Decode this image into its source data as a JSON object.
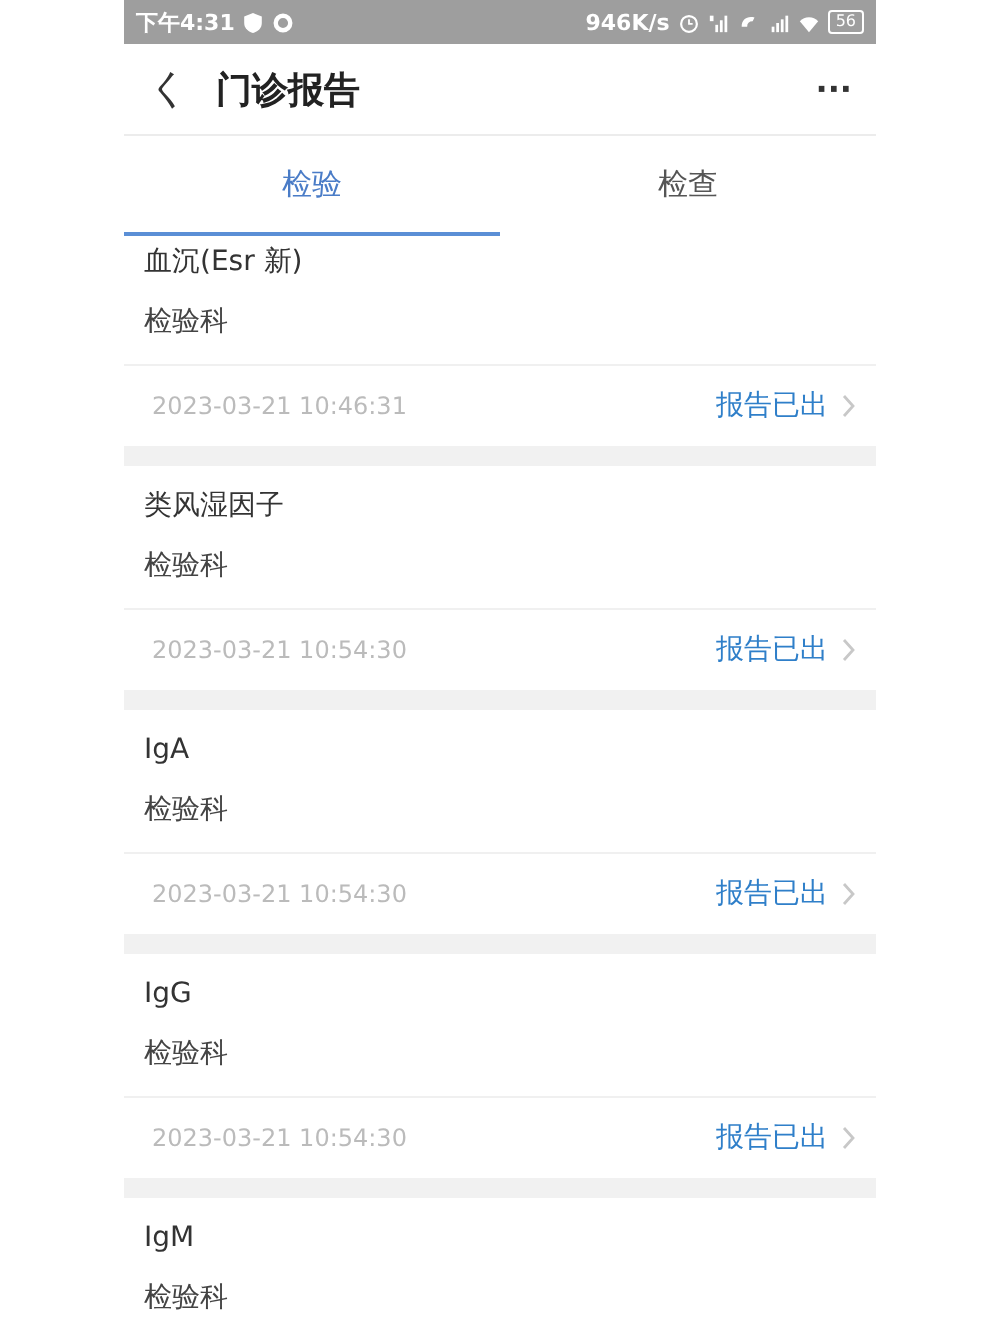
{
  "status_bar": {
    "time": "下午4:31",
    "speed": "946K/s",
    "battery": "56"
  },
  "header": {
    "back": "く",
    "title": "门诊报告",
    "more": "···"
  },
  "tabs": [
    {
      "label": "检验",
      "selected": true
    },
    {
      "label": "检查",
      "selected": false
    }
  ],
  "reports": [
    {
      "name": "血沉(Esr 新)",
      "department": "检验科",
      "datetime": "2023-03-21  10:46:31",
      "status": "报告已出"
    },
    {
      "name": "类风湿因子",
      "department": "检验科",
      "datetime": "2023-03-21  10:54:30",
      "status": "报告已出"
    },
    {
      "name": "IgA",
      "department": "检验科",
      "datetime": "2023-03-21  10:54:30",
      "status": "报告已出"
    },
    {
      "name": "IgG",
      "department": "检验科",
      "datetime": "2023-03-21  10:54:30",
      "status": "报告已出"
    },
    {
      "name": "IgM",
      "department": "检验科"
    }
  ]
}
